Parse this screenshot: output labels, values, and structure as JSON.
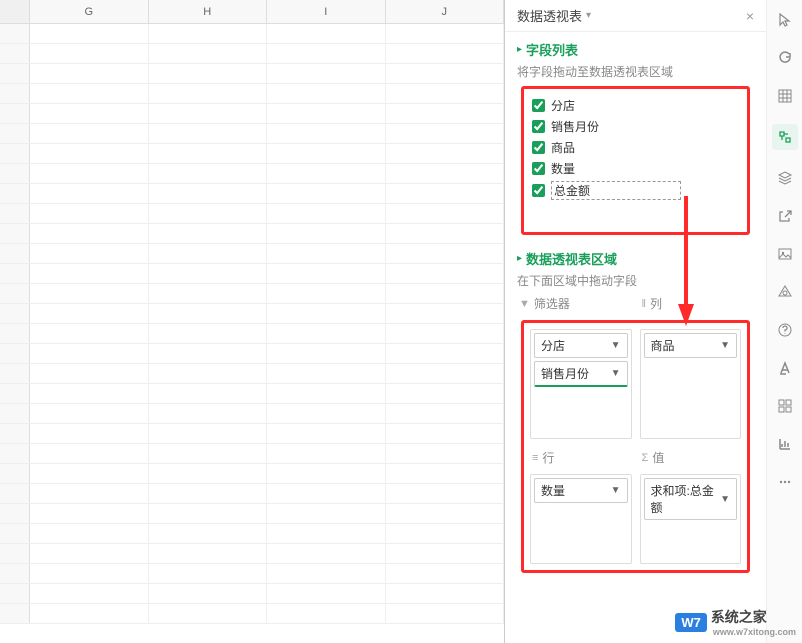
{
  "panel": {
    "title": "数据透视表",
    "dropdown_icon": "▾"
  },
  "fieldList": {
    "title": "字段列表",
    "sub": "将字段拖动至数据透视表区域",
    "items": [
      {
        "label": "分店",
        "checked": true
      },
      {
        "label": "销售月份",
        "checked": true
      },
      {
        "label": "商品",
        "checked": true
      },
      {
        "label": "数量",
        "checked": true
      },
      {
        "label": "总金额",
        "checked": true,
        "editing": true
      }
    ]
  },
  "areas": {
    "title": "数据透视表区域",
    "sub": "在下面区域中拖动字段",
    "filter": {
      "label": "筛选器",
      "items": [
        "分店",
        "销售月份"
      ]
    },
    "columns": {
      "label": "列",
      "items": [
        "商品"
      ]
    },
    "rows": {
      "label": "行",
      "items": [
        "数量"
      ]
    },
    "values": {
      "label": "值",
      "items": [
        "求和项:总金额"
      ]
    }
  },
  "columns": [
    "G",
    "H",
    "I",
    "J"
  ],
  "watermark": {
    "brand": "W7",
    "text": "系统之家",
    "url": "www.w7xitong.com"
  }
}
